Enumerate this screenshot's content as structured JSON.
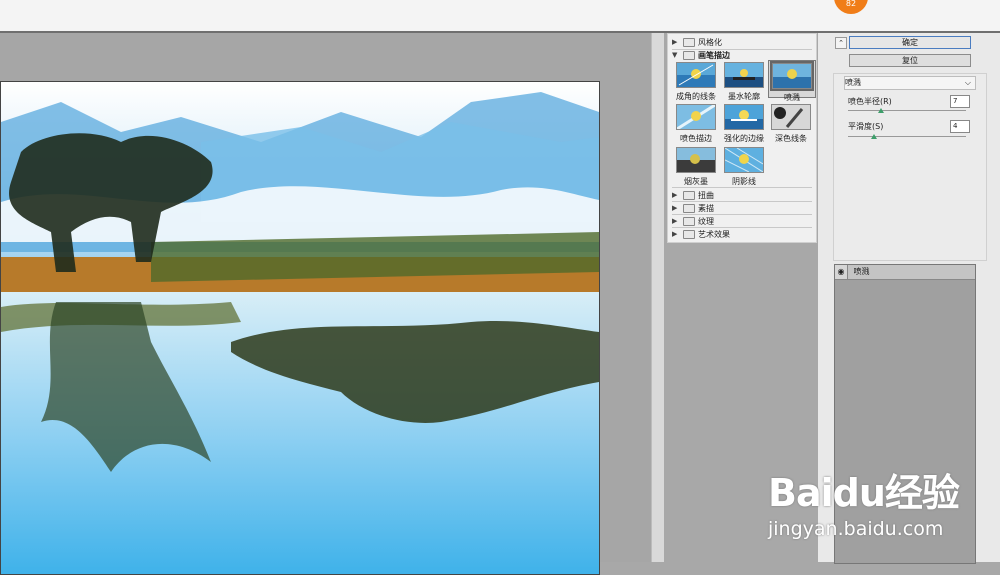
{
  "badge": {
    "text": "82"
  },
  "filter_gallery": {
    "folders_top": [
      {
        "label": "风格化",
        "expanded": false
      },
      {
        "label": "画笔描边",
        "expanded": true
      }
    ],
    "thumbnails": [
      {
        "label": "成角的线条",
        "selected": false
      },
      {
        "label": "墨水轮廓",
        "selected": false
      },
      {
        "label": "喷溅",
        "selected": true
      },
      {
        "label": "喷色描边",
        "selected": false
      },
      {
        "label": "强化的边缘",
        "selected": false
      },
      {
        "label": "深色线条",
        "selected": false
      },
      {
        "label": "烟灰墨",
        "selected": false
      },
      {
        "label": "阴影线",
        "selected": false
      }
    ],
    "folders_bottom": [
      {
        "label": "扭曲",
        "expanded": false
      },
      {
        "label": "素描",
        "expanded": false
      },
      {
        "label": "纹理",
        "expanded": false
      },
      {
        "label": "艺术效果",
        "expanded": false
      }
    ]
  },
  "buttons": {
    "ok": "确定",
    "reset": "复位"
  },
  "settings": {
    "filter_select": "喷溅",
    "params": [
      {
        "label": "喷色半径(R)",
        "value": "7",
        "fraction": 0.28
      },
      {
        "label": "平滑度(S)",
        "value": "4",
        "fraction": 0.22
      }
    ]
  },
  "layers": {
    "active_layer": "喷溅"
  },
  "watermark": {
    "logo": "Baidu经验",
    "url": "jingyan.baidu.com"
  }
}
